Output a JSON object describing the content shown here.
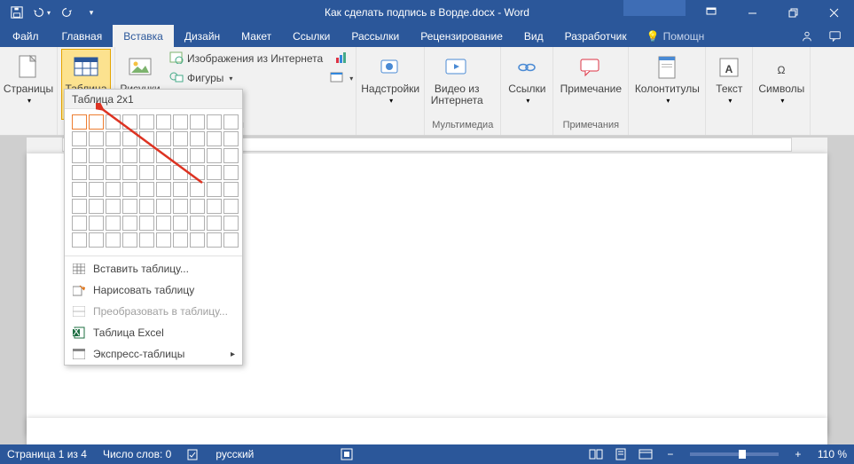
{
  "title": "Как сделать подпись в Ворде.docx - Word",
  "tabs": {
    "file": "Файл",
    "home": "Главная",
    "insert": "Вставка",
    "design": "Дизайн",
    "layout": "Макет",
    "references": "Ссылки",
    "mailings": "Рассылки",
    "review": "Рецензирование",
    "view": "Вид",
    "developer": "Разработчик",
    "tellme": "Помощн"
  },
  "ribbon": {
    "pages": "Страницы",
    "table": "Таблица",
    "pictures": "Рисунки",
    "online_pictures": "Изображения из Интернета",
    "shapes": "Фигуры",
    "addins": "Надстройки",
    "online_video": "Видео из Интернета",
    "links": "Ссылки",
    "comment": "Примечание",
    "header_footer": "Колонтитулы",
    "text": "Текст",
    "symbols": "Символы",
    "media_group": "Мультимедиа",
    "comments_group": "Примечания"
  },
  "table_dropdown": {
    "header": "Таблица 2x1",
    "insert": "Вставить таблицу...",
    "draw": "Нарисовать таблицу",
    "convert": "Преобразовать в таблицу...",
    "excel": "Таблица Excel",
    "quick": "Экспресс-таблицы"
  },
  "status": {
    "page": "Страница 1 из 4",
    "words": "Число слов: 0",
    "lang": "русский",
    "zoom": "110 %"
  }
}
